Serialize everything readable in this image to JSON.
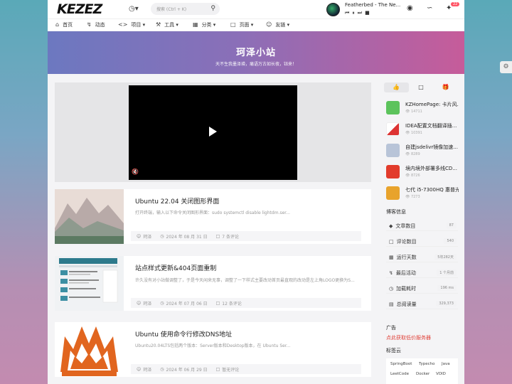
{
  "header": {
    "logo": "KEZEZ",
    "clock_icon": "clock-icon",
    "search_placeholder": "搜索 (Ctrl + K)",
    "player": {
      "title": "Featherbed - The Ne..."
    },
    "notification_count": "22"
  },
  "nav": {
    "items": [
      {
        "label": "首页",
        "icon": "home-icon"
      },
      {
        "label": "动态",
        "icon": "activity-icon"
      },
      {
        "label": "项目",
        "icon": "code-icon"
      },
      {
        "label": "工具",
        "icon": "tool-icon"
      },
      {
        "label": "分类",
        "icon": "grid-icon"
      },
      {
        "label": "页面",
        "icon": "page-icon"
      },
      {
        "label": "友链",
        "icon": "user-icon"
      }
    ]
  },
  "banner": {
    "title": "珂泽小站",
    "subtitle": "天不生我墨泽瑛，痛语万古如长夜，钰来！"
  },
  "posts": [
    {
      "title": "Ubuntu 22.04 关闭图形界面",
      "excerpt": "打开终端，输入以下命令关闭图形界面：sudo systemctl disable lightdm.ser...",
      "author": "珂泽",
      "date": "2024 年 08 月 31 日",
      "comments": "7 条评论"
    },
    {
      "title": "站点样式更新&404页面重制",
      "excerpt": "许久没有对小站做调整了，于是今天闲来无事，调整了一下样式主要改动首页最直观的改动是左上角LOGO更换为S...",
      "author": "珂泽",
      "date": "2024 年 07 月 06 日",
      "comments": "12 条评论"
    },
    {
      "title": "Ubuntu 使用命令行修改DNS地址",
      "excerpt": "Ubuntu20.04LTS包括两个版本：Server版本和Desktop版本，在 Ubuntu Ser...",
      "author": "珂泽",
      "date": "2024 年 06 月 29 日",
      "comments": "暂无评论"
    }
  ],
  "sidebar": {
    "hot": [
      {
        "title": "KZHomePage: 卡片风...",
        "views": "14711"
      },
      {
        "title": "IDEA配置文档翻译插...",
        "views": "10391"
      },
      {
        "title": "自建jsdelivr镜像加速...",
        "views": "8289"
      },
      {
        "title": "境内境外部署多线CD...",
        "views": "8726"
      },
      {
        "title": "七代 i5-7300HQ 惠普光...",
        "views": "7273"
      }
    ],
    "info_title": "博客信息",
    "info": [
      {
        "label": "文章数目",
        "value": "87",
        "icon": "article-icon"
      },
      {
        "label": "评论数目",
        "value": "540",
        "icon": "comment-icon"
      },
      {
        "label": "运行天数",
        "value": "5年282天",
        "icon": "calendar-icon"
      },
      {
        "label": "最后活动",
        "value": "1 个月前",
        "icon": "activity-icon"
      },
      {
        "label": "加载耗时",
        "value": "196 ms",
        "icon": "timer-icon"
      },
      {
        "label": "总阅读量",
        "value": "329,373",
        "icon": "book-icon"
      }
    ],
    "ad_title": "广告",
    "ad_link": "点此获取低价服务器",
    "tags_title": "标签云",
    "tags": [
      "SpringBoot",
      "Typecho",
      "Java",
      "LeetCode",
      "Docker",
      "VOID"
    ]
  }
}
